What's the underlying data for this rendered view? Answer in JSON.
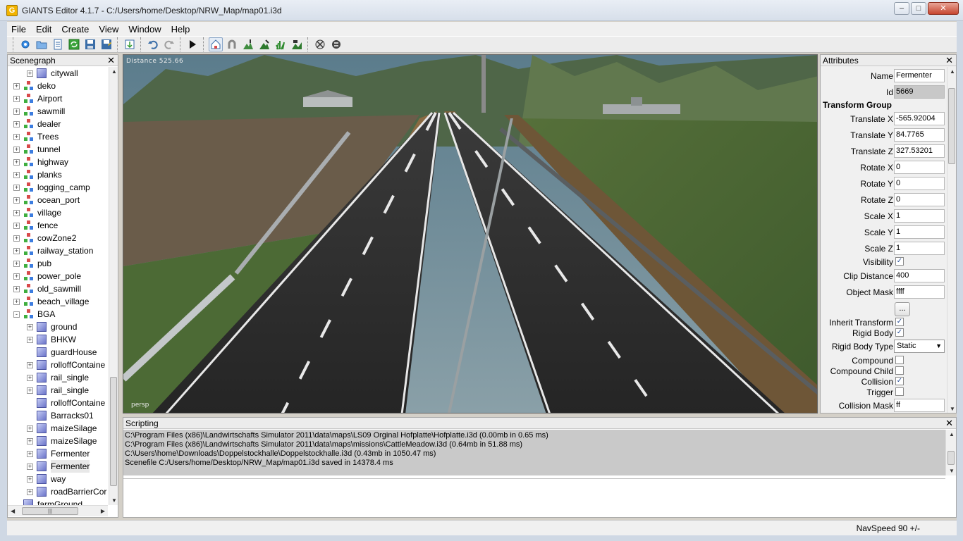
{
  "window": {
    "title": "GIANTS Editor 4.1.7 - C:/Users/home/Desktop/NRW_Map/map01.i3d",
    "app_icon_letter": "G",
    "minimize_icon": "minimize-icon",
    "maximize_icon": "maximize-icon",
    "close_icon": "close-icon"
  },
  "menu": {
    "items": [
      "File",
      "Edit",
      "Create",
      "View",
      "Window",
      "Help"
    ]
  },
  "toolbar": {
    "icons": [
      "new-scene-icon",
      "open-icon",
      "properties-icon",
      "refresh-icon",
      "save-icon",
      "save-as-icon",
      "import-icon",
      "undo-icon",
      "redo-icon",
      "play-icon",
      "select-mode-icon",
      "magnet-icon",
      "terrain-sculpt-icon",
      "terrain-paint-icon",
      "foliage-paint-icon",
      "terrain-info-icon",
      "debug-icon",
      "clear-icon"
    ]
  },
  "scenegraph": {
    "title": "Scenegraph",
    "items": [
      {
        "label": "citywall",
        "kind": "shape",
        "depth": 1,
        "toggle": "+"
      },
      {
        "label": "deko",
        "kind": "group",
        "depth": 0,
        "toggle": "+"
      },
      {
        "label": "Airport",
        "kind": "group",
        "depth": 0,
        "toggle": "+"
      },
      {
        "label": "sawmill",
        "kind": "group",
        "depth": 0,
        "toggle": "+"
      },
      {
        "label": "dealer",
        "kind": "group",
        "depth": 0,
        "toggle": "+"
      },
      {
        "label": "Trees",
        "kind": "group",
        "depth": 0,
        "toggle": "+"
      },
      {
        "label": "tunnel",
        "kind": "group",
        "depth": 0,
        "toggle": "+"
      },
      {
        "label": "highway",
        "kind": "group",
        "depth": 0,
        "toggle": "+"
      },
      {
        "label": "planks",
        "kind": "group",
        "depth": 0,
        "toggle": "+"
      },
      {
        "label": "logging_camp",
        "kind": "group",
        "depth": 0,
        "toggle": "+"
      },
      {
        "label": "ocean_port",
        "kind": "group",
        "depth": 0,
        "toggle": "+"
      },
      {
        "label": "village",
        "kind": "group",
        "depth": 0,
        "toggle": "+"
      },
      {
        "label": "fence",
        "kind": "group",
        "depth": 0,
        "toggle": "+"
      },
      {
        "label": "cowZone2",
        "kind": "group",
        "depth": 0,
        "toggle": "+"
      },
      {
        "label": "railway_station",
        "kind": "group",
        "depth": 0,
        "toggle": "+"
      },
      {
        "label": "pub",
        "kind": "group",
        "depth": 0,
        "toggle": "+"
      },
      {
        "label": "power_pole",
        "kind": "group",
        "depth": 0,
        "toggle": "+"
      },
      {
        "label": "old_sawmill",
        "kind": "group",
        "depth": 0,
        "toggle": "+"
      },
      {
        "label": "beach_village",
        "kind": "group",
        "depth": 0,
        "toggle": "+"
      },
      {
        "label": "BGA",
        "kind": "group",
        "depth": 0,
        "toggle": "-"
      },
      {
        "label": "ground",
        "kind": "shape",
        "depth": 1,
        "toggle": "+"
      },
      {
        "label": "BHKW",
        "kind": "shape",
        "depth": 1,
        "toggle": "+"
      },
      {
        "label": "guardHouse",
        "kind": "shape",
        "depth": 1,
        "toggle": ""
      },
      {
        "label": "rolloffContaine",
        "kind": "shape",
        "depth": 1,
        "toggle": "+"
      },
      {
        "label": "rail_single",
        "kind": "shape",
        "depth": 1,
        "toggle": "+"
      },
      {
        "label": "rail_single",
        "kind": "shape",
        "depth": 1,
        "toggle": "+"
      },
      {
        "label": "rolloffContaine",
        "kind": "shape",
        "depth": 1,
        "toggle": ""
      },
      {
        "label": "Barracks01",
        "kind": "shape",
        "depth": 1,
        "toggle": ""
      },
      {
        "label": "maizeSilage",
        "kind": "shape",
        "depth": 1,
        "toggle": "+"
      },
      {
        "label": "maizeSilage",
        "kind": "shape",
        "depth": 1,
        "toggle": "+"
      },
      {
        "label": "Fermenter",
        "kind": "shape",
        "depth": 1,
        "toggle": "+"
      },
      {
        "label": "Fermenter",
        "kind": "shape",
        "depth": 1,
        "toggle": "+",
        "selected": true
      },
      {
        "label": "way",
        "kind": "shape",
        "depth": 1,
        "toggle": "+"
      },
      {
        "label": "roadBarrierCor",
        "kind": "shape",
        "depth": 1,
        "toggle": "+"
      },
      {
        "label": "farmGround",
        "kind": "shape",
        "depth": 0,
        "toggle": ""
      }
    ]
  },
  "viewport": {
    "distance_label": "Distance 525.66",
    "camera_label": "persp"
  },
  "attributes": {
    "title": "Attributes",
    "name_label": "Name",
    "name_value": "Fermenter",
    "id_label": "Id",
    "id_value": "5669",
    "section_label": "Transform Group",
    "translate_x_label": "Translate X",
    "translate_x": "-565.92004",
    "translate_y_label": "Translate Y",
    "translate_y": "84.7765",
    "translate_z_label": "Translate Z",
    "translate_z": "327.53201",
    "rotate_x_label": "Rotate X",
    "rotate_x": "0",
    "rotate_y_label": "Rotate Y",
    "rotate_y": "0",
    "rotate_z_label": "Rotate Z",
    "rotate_z": "0",
    "scale_x_label": "Scale X",
    "scale_x": "1",
    "scale_y_label": "Scale Y",
    "scale_y": "1",
    "scale_z_label": "Scale Z",
    "scale_z": "1",
    "visibility_label": "Visibility",
    "clip_distance_label": "Clip Distance",
    "clip_distance": "400",
    "object_mask_label": "Object Mask",
    "object_mask": "ffff",
    "more_button": "...",
    "inherit_transform_label": "Inherit Transform",
    "rigid_body_label": "Rigid Body",
    "rigid_body_type_label": "Rigid Body Type",
    "rigid_body_type": "Static",
    "compound_label": "Compound",
    "compound_child_label": "Compound Child",
    "collision_label": "Collision",
    "trigger_label": "Trigger",
    "collision_mask_label": "Collision Mask",
    "collision_mask": "ff",
    "check_mark": "✓"
  },
  "scripting": {
    "title": "Scripting",
    "log": [
      "C:\\Program Files (x86)\\Landwirtschafts Simulator 2011\\data\\maps\\LS09 Orginal Hofplatte\\Hofplatte.i3d (0.00mb in 0.65 ms)",
      "C:\\Program Files (x86)\\Landwirtschafts Simulator 2011\\data\\maps\\missions\\CattleMeadow.i3d (0.64mb in 51.88 ms)",
      "C:\\Users\\home\\Downloads\\Doppelstockhalle\\Doppelstockhalle.i3d (0.43mb in 1050.47 ms)",
      "Scenefile C:/Users/home/Desktop/NRW_Map/map01.i3d saved in 14378.4 ms"
    ]
  },
  "statusbar": {
    "nav_speed": "NavSpeed 90 +/-"
  }
}
